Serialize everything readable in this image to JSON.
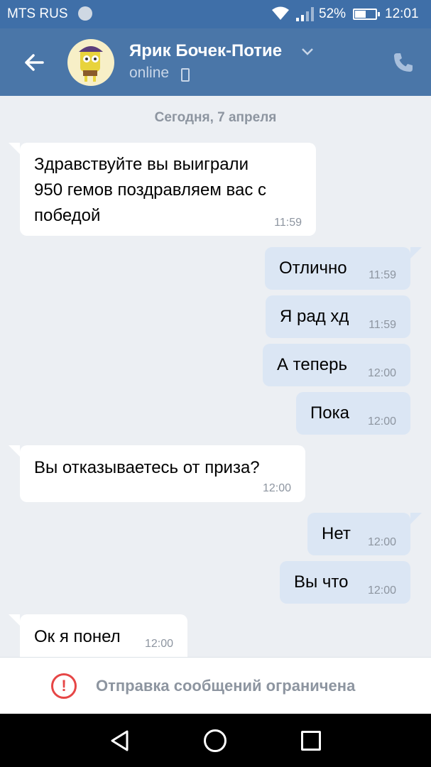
{
  "status_bar": {
    "carrier": "MTS RUS",
    "battery_percent": "52%",
    "battery_level": 0.52,
    "time": "12:01",
    "icons": [
      "carrier-avatar-icon",
      "wifi-icon",
      "signal-icon",
      "battery-icon"
    ]
  },
  "header": {
    "contact_name": "Ярик Бочек-Потие",
    "contact_status": "online",
    "icons": [
      "back-arrow-icon",
      "chevron-down-icon",
      "mobile-phone-icon",
      "call-icon"
    ]
  },
  "chat": {
    "date": "Сегодня, 7 апреля",
    "messages": [
      {
        "direction": "in",
        "lines": [
          "Здравствуйте вы выиграли",
          "950 гемов поздравляем вас с",
          "победой"
        ],
        "time": "11:59"
      },
      {
        "direction": "out",
        "text": "Отлично",
        "time": "11:59"
      },
      {
        "direction": "out",
        "text": "Я рад хд",
        "time": "11:59"
      },
      {
        "direction": "out",
        "text": "А теперь",
        "time": "12:00"
      },
      {
        "direction": "out",
        "text": "Пока",
        "time": "12:00"
      },
      {
        "direction": "in",
        "text": "Вы отказываетесь от приза?",
        "time": "12:00"
      },
      {
        "direction": "out",
        "text": "Нет",
        "time": "12:00"
      },
      {
        "direction": "out",
        "text": "Вы что",
        "time": "12:00"
      },
      {
        "direction": "in",
        "text": "Ок я понел",
        "time": "12:00"
      }
    ]
  },
  "restriction": {
    "icon": "!",
    "text": "Отправка сообщений ограничена"
  },
  "nav_bar": {
    "icons": [
      "nav-back-icon",
      "nav-home-icon",
      "nav-recents-icon"
    ]
  },
  "colors": {
    "header": "#4a76a8",
    "status_bar": "#3f6fa8",
    "background": "#eceff3",
    "incoming_bubble": "#ffffff",
    "outgoing_bubble": "#dbe6f4",
    "error": "#e64646"
  }
}
